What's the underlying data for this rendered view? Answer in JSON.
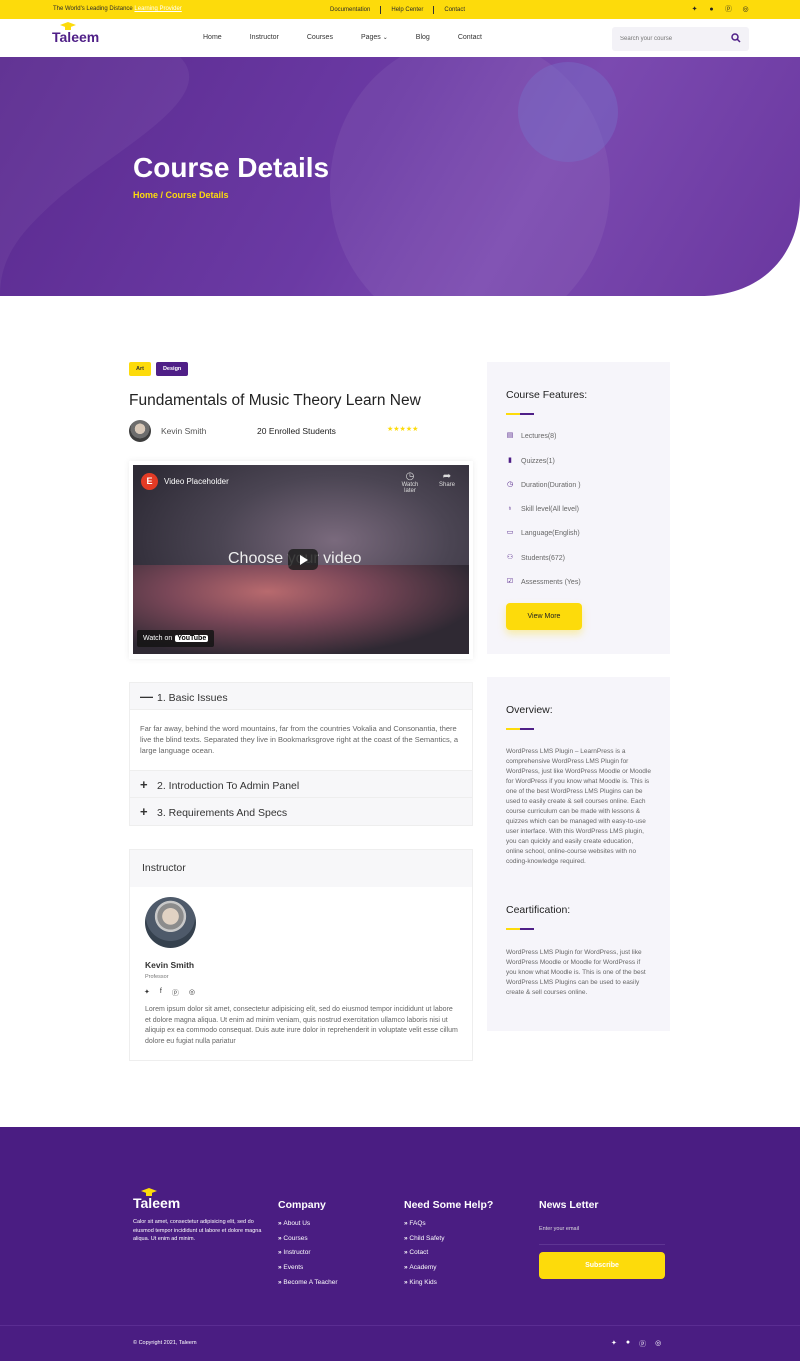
{
  "topbar": {
    "tagline": "The World's Leading Distance",
    "tagline_highlight": "Learning Provider",
    "links": [
      "Documentation",
      "Help Center",
      "Contact"
    ]
  },
  "brand": {
    "name": "Taleem",
    "accent": "#fddb0b",
    "primary": "#4f1f87"
  },
  "nav": {
    "items": [
      "Home",
      "Instructor",
      "Courses",
      "Pages",
      "Blog",
      "Contact"
    ],
    "search_placeholder": "Search your course"
  },
  "hero": {
    "title": "Course Details",
    "breadcrumb": "Home / Course Details"
  },
  "course": {
    "tags": [
      "Art",
      "Design"
    ],
    "title": "Fundamentals of Music Theory Learn New",
    "author": "Kevin Smith",
    "enrolled": "20 Enrolled Students",
    "rating": "★★★★★"
  },
  "video": {
    "title": "Video Placeholder",
    "watch_later": "Watch later",
    "share": "Share",
    "center_text": "Choose your video",
    "watch_on": "Watch on",
    "youtube": "YouTube"
  },
  "accordion": [
    {
      "title": "1. Basic Issues",
      "symbol": "—",
      "body": "Far far away, behind the word mountains, far from the countries Vokalia and Consonantia, there live the blind texts. Separated they live in Bookmarksgrove right at the coast of the Semantics, a large language ocean."
    },
    {
      "title": "2. Introduction To Admin Panel",
      "symbol": "+"
    },
    {
      "title": "3. Requirements And Specs",
      "symbol": "+"
    }
  ],
  "instructor": {
    "heading": "Instructor",
    "name": "Kevin Smith",
    "role": "Professor",
    "bio": "Lorem ipsum dolor sit amet, consectetur adipisicing elit, sed do eiusmod tempor incididunt ut labore et dolore magna aliqua. Ut enim ad minim veniam, quis nostrud exercitation ullamco laboris nisi ut aliquip ex ea commodo consequat. Duis aute irure dolor in reprehenderit in voluptate velit esse cillum dolore eu fugiat nulla pariatur"
  },
  "features": {
    "heading": "Course Features:",
    "items": [
      "Lectures(8)",
      "Quizzes(1)",
      "Duration(Duration )",
      "Skill level(All level)",
      "Language(English)",
      "Students(672)",
      "Assessments (Yes)"
    ],
    "button": "View More"
  },
  "overview": {
    "heading": "Overview:",
    "text": "WordPress LMS Plugin – LearnPress is a comprehensive WordPress LMS Plugin for WordPress, just like WordPress Moodle or Moodle for WordPress if you know what Moodle is. This is one of the best WordPress LMS Plugins can be used to easily create & sell courses online. Each course curriculum can be made with lessons & quizzes which can be managed with easy-to-use user interface. With this WordPress LMS plugin, you can quickly and easily create education, online school, online-course websites with no coding-knowledge required.",
    "cert_heading": "Ceartification:",
    "cert_text": "WordPress LMS Plugin for WordPress, just like WordPress Moodle or Moodle for WordPress if you know what Moodle is. This is one of the best WordPress LMS Plugins can be used to easily create & sell courses online."
  },
  "footer": {
    "logo": "Taleem",
    "desc": "Calor sit amet, consectetur adipisicing elit, sed do eiusmod tempor incididunt ut labore et dolore magna aliqua. Ut enim ad minim.",
    "company_heading": "Company",
    "company": [
      "About Us",
      "Courses",
      "Instructor",
      "Events",
      "Become A Teacher"
    ],
    "help_heading": "Need Some Help?",
    "help": [
      "FAQs",
      "Child Safety",
      "Cotact",
      "Academy",
      "King Kids"
    ],
    "news_heading": "News Letter",
    "email_placeholder": "Enter your email",
    "subscribe": "Subscribe",
    "copyright": "© Copyright 2021, Taleem"
  },
  "icons": [
    "twitter-icon",
    "facebook-icon",
    "pinterest-icon",
    "instagram-icon",
    "search-icon",
    "chevron-down-icon",
    "play-icon"
  ]
}
